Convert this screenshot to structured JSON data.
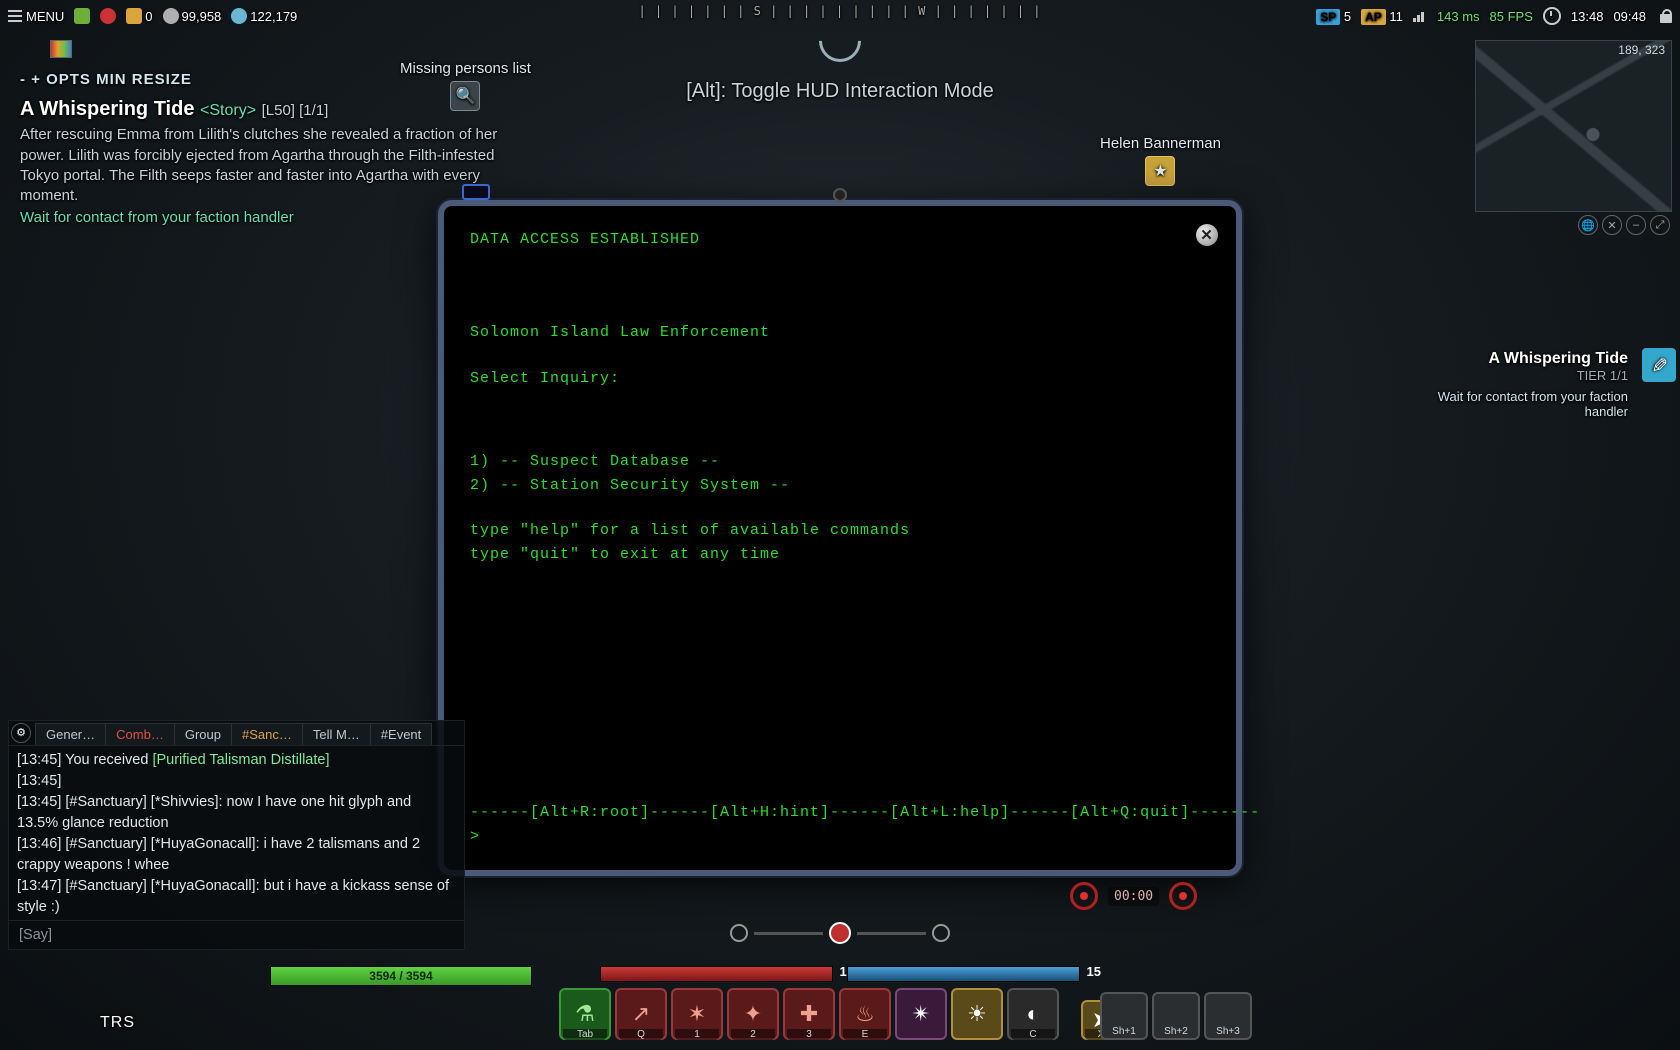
{
  "topbar": {
    "menu_label": "MENU",
    "currencies": {
      "c1": "0",
      "c2": "99,958",
      "c3": "122,179"
    },
    "sp_label": "SP",
    "sp_val": "5",
    "ap_label": "AP",
    "ap_val": "11",
    "ping": "143 ms",
    "fps": "85 FPS",
    "time_left": "13:48",
    "time_right": "09:48"
  },
  "compass": {
    "ticks": "| | | | | | |   S   | | | | | | | | |   W   | | | | | | |"
  },
  "hud_hint": "[Alt]: Toggle HUD Interaction Mode",
  "npc": {
    "missing": "Missing persons list",
    "helen": "Helen Bannerman"
  },
  "minimap": {
    "coords": "189, 323"
  },
  "mission": {
    "opts": "- + OPTS MIN RESIZE",
    "title": "A Whispering Tide",
    "tag": "<Story>",
    "lvl": "[L50] [1/1]",
    "desc": "After rescuing Emma from Lilith's clutches she revealed a fraction of her power. Lilith was forcibly ejected from Agartha through the Filth-infested Tokyo portal. The Filth seeps faster and faster into Agartha with every moment.",
    "objective": "Wait for contact from your faction handler"
  },
  "right_mission": {
    "title": "A Whispering Tide",
    "tier": "TIER 1/1",
    "obj": "Wait for contact from your faction handler"
  },
  "terminal": {
    "header": "DATA ACCESS ESTABLISHED",
    "org": "Solomon Island Law Enforcement",
    "prompt_label": "Select Inquiry:",
    "opt1": "1) -- Suspect Database --",
    "opt2": "2) -- Station Security System --",
    "help1": "type \"help\" for a list of available commands",
    "help2": "type \"quit\" to exit at any time",
    "footer": "------[Alt+R:root]------[Alt+H:hint]------[Alt+L:help]------[Alt+Q:quit]-------",
    "cursor": ">",
    "close": "✕"
  },
  "chat": {
    "tabs": [
      "Gener…",
      "Comb…",
      "Group",
      "#Sanc…",
      "Tell M…",
      "#Event"
    ],
    "lines": [
      {
        "t": "[13:45]",
        "rest": " You received ",
        "item": "[Purified Talisman Distillate]"
      },
      {
        "t": "[13:45]",
        "rest": ""
      },
      {
        "t": "[13:45]",
        "rest": " [#Sanctuary] [*Shivvies]: now I have one hit glyph and 13.5% glance reduction"
      },
      {
        "t": "[13:46]",
        "rest": " [#Sanctuary] [*HuyaGonacall]: i have 2 talismans and 2 crappy weapons ! whee"
      },
      {
        "t": "[13:47]",
        "rest": " [#Sanctuary] [*HuyaGonacall]: but i have a kickass sense of style :)"
      }
    ],
    "input_placeholder": "[Say]"
  },
  "hp": {
    "text": "3594 / 3594"
  },
  "resources": {
    "left": "15",
    "right": "15"
  },
  "abilities": [
    {
      "key": "Tab",
      "cls": "ab-green",
      "glyph": "⚗"
    },
    {
      "key": "Q",
      "cls": "ab-red",
      "glyph": "↗"
    },
    {
      "key": "1",
      "cls": "ab-red",
      "glyph": "✶"
    },
    {
      "key": "2",
      "cls": "ab-red",
      "glyph": "✦"
    },
    {
      "key": "3",
      "cls": "ab-red",
      "glyph": "✚"
    },
    {
      "key": "E",
      "cls": "ab-red",
      "glyph": "♨"
    },
    {
      "key": "",
      "cls": "ab-purple",
      "glyph": "✴"
    },
    {
      "key": "",
      "cls": "ab-gold",
      "glyph": "☀"
    },
    {
      "key": "C",
      "cls": "ab-grey",
      "glyph": "◐"
    }
  ],
  "dodge": {
    "key": "X",
    "glyph": "➤"
  },
  "gadgets": [
    {
      "key": "Sh+1"
    },
    {
      "key": "Sh+2"
    },
    {
      "key": "Sh+3"
    }
  ],
  "rec": {
    "time": "00:00"
  },
  "corner": "TRS"
}
